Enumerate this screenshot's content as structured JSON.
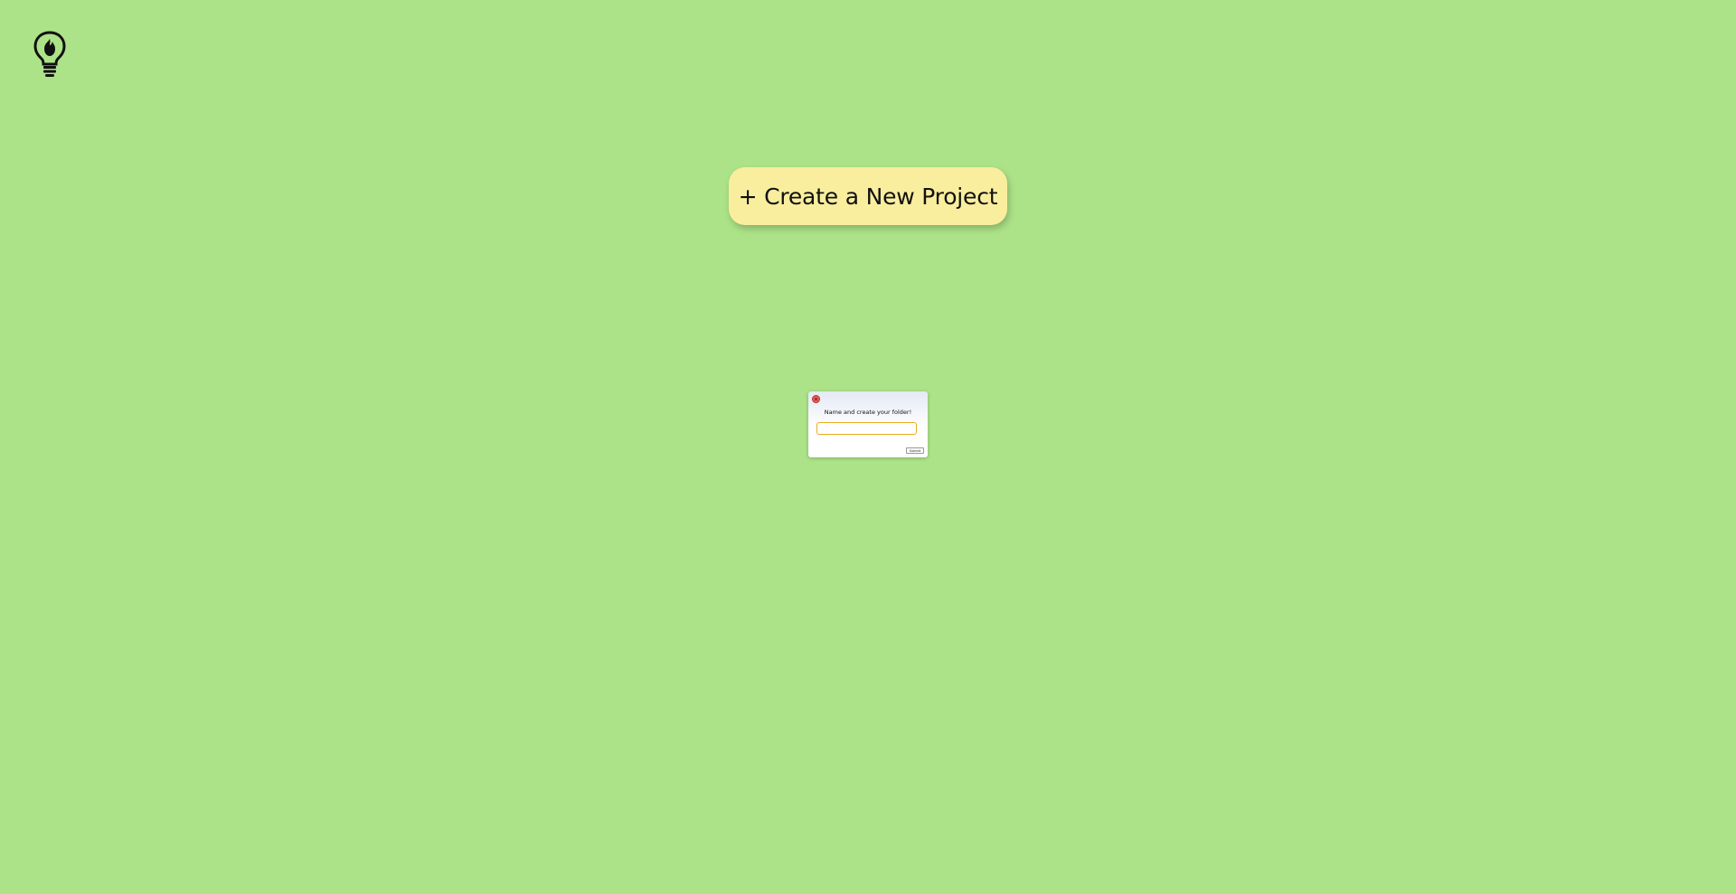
{
  "app": {
    "logo_icon": "lightbulb-flame-icon"
  },
  "main": {
    "create_project_label": "+ Create a New Project",
    "create_project_bg": "#f9ee9e"
  },
  "modal": {
    "close_icon": "close-icon",
    "title": "Name and create your folder!",
    "folder_input_value": "",
    "folder_input_placeholder": "",
    "submit_label": "Submit",
    "accent": "#e9ad1f"
  },
  "theme": {
    "background": "#ade388"
  }
}
